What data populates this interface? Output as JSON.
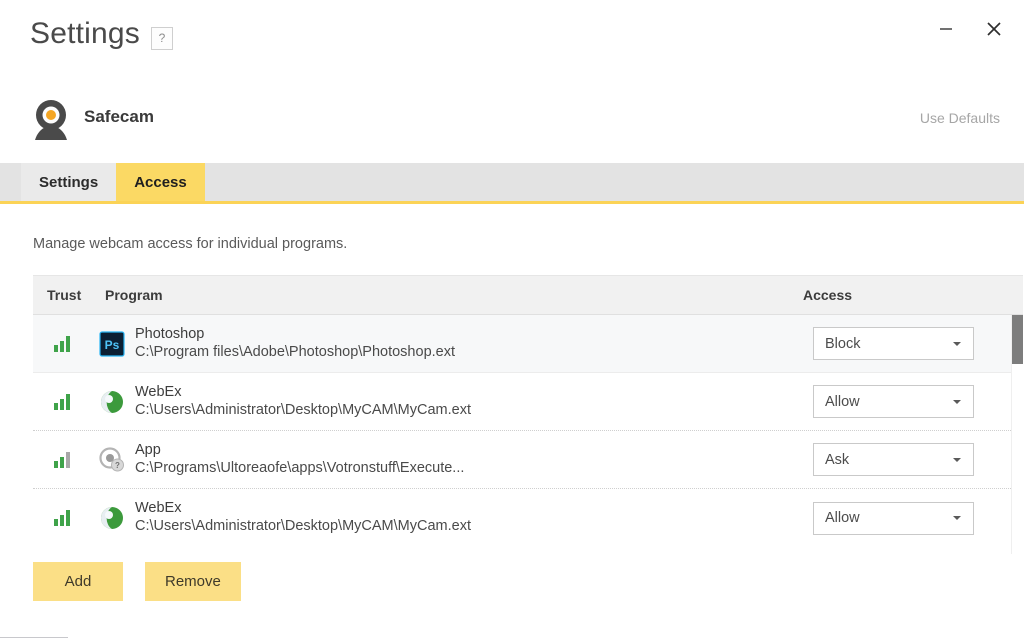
{
  "window": {
    "title": "Settings",
    "help_label": "?",
    "minimize_label": "minimize",
    "close_label": "close"
  },
  "product": {
    "name": "Safecam",
    "icon": "webcam-icon",
    "use_defaults_label": "Use Defaults"
  },
  "tabs": [
    {
      "label": "Settings",
      "active": false
    },
    {
      "label": "Access",
      "active": true
    }
  ],
  "main": {
    "description": "Manage webcam access for individual programs.",
    "table": {
      "headers": {
        "trust": "Trust",
        "program": "Program",
        "access": "Access"
      },
      "rows": [
        {
          "trust_level": 3,
          "trust_bars": [
            "green",
            "green",
            "green"
          ],
          "icon": "photoshop-icon",
          "name": "Photoshop",
          "path": "C:\\Program files\\Adobe\\Photoshop\\Photoshop.ext",
          "access": "Block",
          "selected": true
        },
        {
          "trust_level": 3,
          "trust_bars": [
            "green",
            "green",
            "green"
          ],
          "icon": "webex-icon",
          "name": "WebEx",
          "path": "C:\\Users\\Administrator\\Desktop\\MyCAM\\MyCam.ext",
          "access": "Allow",
          "selected": false
        },
        {
          "trust_level": 2,
          "trust_bars": [
            "green",
            "green",
            "gray"
          ],
          "icon": "unknown-app-icon",
          "name": "App",
          "path": "C:\\Programs\\Ultoreaofe\\apps\\Votronstuff\\Execute...",
          "access": "Ask",
          "selected": false
        },
        {
          "trust_level": 3,
          "trust_bars": [
            "green",
            "green",
            "green"
          ],
          "icon": "webex-icon",
          "name": "WebEx",
          "path": "C:\\Users\\Administrator\\Desktop\\MyCAM\\MyCam.ext",
          "access": "Allow",
          "selected": false
        }
      ],
      "access_options": [
        "Allow",
        "Block",
        "Ask"
      ]
    }
  },
  "footer": {
    "add_label": "Add",
    "remove_label": "Remove"
  },
  "colors": {
    "accent_yellow": "#fbd964",
    "accent_button": "#fbdf86",
    "tabstrip_gray": "#e3e3e3",
    "trust_green": "#3fa34a",
    "trust_gray": "#a8a8a8",
    "lens_orange": "#f5a623"
  }
}
